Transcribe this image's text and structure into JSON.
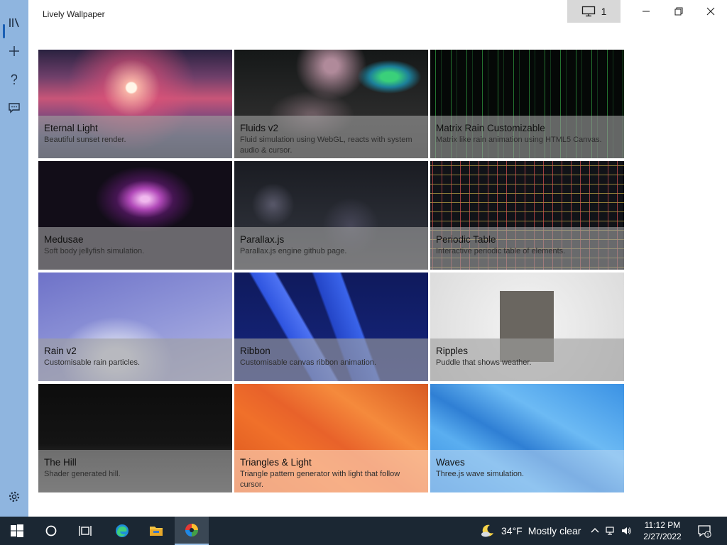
{
  "app": {
    "title": "Lively Wallpaper"
  },
  "toolbar": {
    "monitor_count": "1"
  },
  "sidebar": {
    "items": [
      {
        "name": "library",
        "icon": "library-icon"
      },
      {
        "name": "add",
        "icon": "plus-icon"
      },
      {
        "name": "help",
        "icon": "question-icon"
      },
      {
        "name": "feedback",
        "icon": "feedback-icon"
      },
      {
        "name": "settings",
        "icon": "gear-icon"
      }
    ]
  },
  "wallpapers": [
    {
      "title": "Eternal Light",
      "desc": "Beautiful sunset render."
    },
    {
      "title": "Fluids v2",
      "desc": "Fluid simulation using WebGL, reacts with system audio & cursor."
    },
    {
      "title": "Matrix Rain Customizable",
      "desc": "Matrix like rain animation using HTML5 Canvas."
    },
    {
      "title": "Medusae",
      "desc": "Soft body jellyfish simulation."
    },
    {
      "title": "Parallax.js",
      "desc": "Parallax.js engine github page."
    },
    {
      "title": "Periodic Table",
      "desc": "Interactive periodic table of elements."
    },
    {
      "title": "Rain v2",
      "desc": "Customisable rain particles."
    },
    {
      "title": "Ribbon",
      "desc": "Customisable canvas ribbon animation."
    },
    {
      "title": "Ripples",
      "desc": "Puddle that shows weather."
    },
    {
      "title": "The Hill",
      "desc": "Shader generated hill."
    },
    {
      "title": "Triangles & Light",
      "desc": "Triangle pattern generator with light that follow cursor."
    },
    {
      "title": "Waves",
      "desc": "Three.js wave simulation."
    }
  ],
  "taskbar": {
    "weather_temp": "34°F",
    "weather_text": "Mostly clear",
    "time": "11:12 PM",
    "date": "2/27/2022",
    "notification_count": "1"
  },
  "colors": {
    "sidebar": "#8fb5df",
    "accent": "#1f6fc2",
    "taskbar": "#1b2733"
  }
}
